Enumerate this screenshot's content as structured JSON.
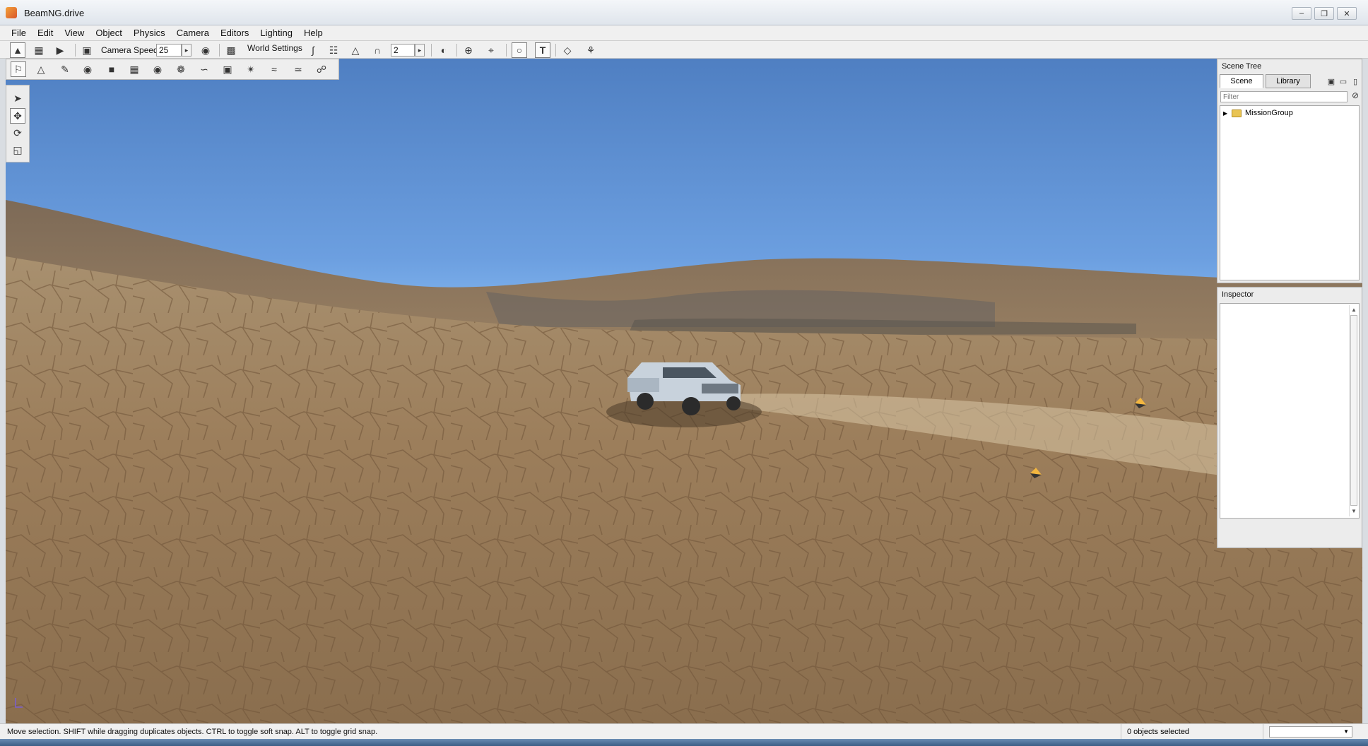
{
  "window": {
    "title": "BeamNG.drive",
    "minimize_icon": "minimize-icon",
    "maximize_icon": "restore-icon",
    "close_icon": "close-icon"
  },
  "menu": [
    "File",
    "Edit",
    "View",
    "Object",
    "Physics",
    "Camera",
    "Editors",
    "Lighting",
    "Help"
  ],
  "toolbar": {
    "camera_speed_label": "Camera Speed",
    "camera_speed_value": "25",
    "world_settings_label": "World Settings",
    "grid_value": "2"
  },
  "scene_tree": {
    "title": "Scene Tree",
    "tabs": [
      "Scene",
      "Library"
    ],
    "active_tab": "Scene",
    "filter_placeholder": "Filter",
    "items": [
      {
        "label": "MissionGroup",
        "icon": "folder-icon",
        "expanded": false
      }
    ]
  },
  "inspector": {
    "title": "Inspector"
  },
  "statusbar": {
    "hint": "Move selection.  SHIFT while dragging duplicates objects.  CTRL to toggle soft snap.  ALT to toggle grid snap.",
    "selection": "0 objects selected"
  },
  "colors": {
    "sky_top": "#4f7fc2",
    "sky_horizon": "#a5d2f8",
    "ground": "#9a7d5a",
    "accent": "#f3a23a"
  }
}
